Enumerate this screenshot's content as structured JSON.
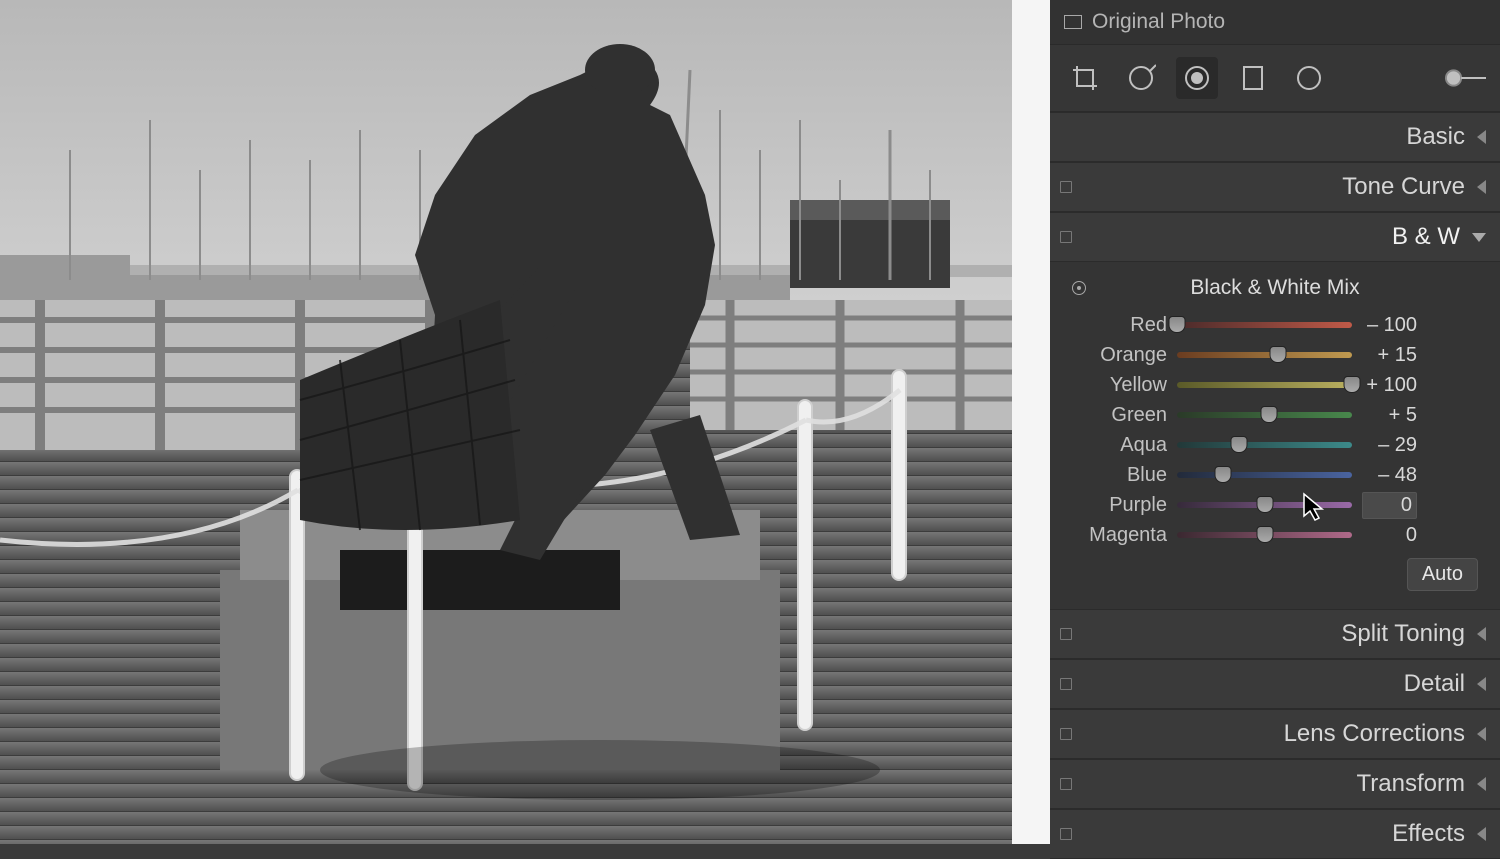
{
  "header": {
    "original_photo": "Original Photo"
  },
  "tools": {
    "crop": "crop-icon",
    "spot": "spot-removal-icon",
    "redeye": "redeye-icon",
    "graduated": "graduated-filter-icon",
    "radial": "radial-filter-icon",
    "brush": "adjustment-brush-icon"
  },
  "panels": {
    "basic": "Basic",
    "tone_curve": "Tone Curve",
    "bw": "B & W",
    "split_toning": "Split Toning",
    "detail": "Detail",
    "lens_corrections": "Lens Corrections",
    "transform": "Transform",
    "effects": "Effects"
  },
  "bw": {
    "title": "Black & White Mix",
    "auto": "Auto",
    "channels": [
      {
        "name": "Red",
        "value": -100,
        "display": "– 100",
        "pos": 0,
        "grad": [
          "#4a2a2a",
          "#c05a48"
        ]
      },
      {
        "name": "Orange",
        "value": 15,
        "display": "+ 15",
        "pos": 57.5,
        "grad": [
          "#6a3c20",
          "#c09a50"
        ]
      },
      {
        "name": "Yellow",
        "value": 100,
        "display": "+ 100",
        "pos": 100,
        "grad": [
          "#5a5a28",
          "#bab060"
        ]
      },
      {
        "name": "Green",
        "value": 5,
        "display": "+ 5",
        "pos": 52.5,
        "grad": [
          "#2a3a28",
          "#48884c"
        ]
      },
      {
        "name": "Aqua",
        "value": -29,
        "display": "– 29",
        "pos": 35.5,
        "grad": [
          "#223838",
          "#3c8a8a"
        ]
      },
      {
        "name": "Blue",
        "value": -48,
        "display": "– 48",
        "pos": 26,
        "grad": [
          "#222a3a",
          "#4a64a0"
        ]
      },
      {
        "name": "Purple",
        "value": 0,
        "display": "0",
        "pos": 50,
        "grad": [
          "#362a3a",
          "#9a6aa8"
        ]
      },
      {
        "name": "Magenta",
        "value": 0,
        "display": "0",
        "pos": 50,
        "grad": [
          "#3a2830",
          "#b06a8a"
        ]
      }
    ]
  }
}
